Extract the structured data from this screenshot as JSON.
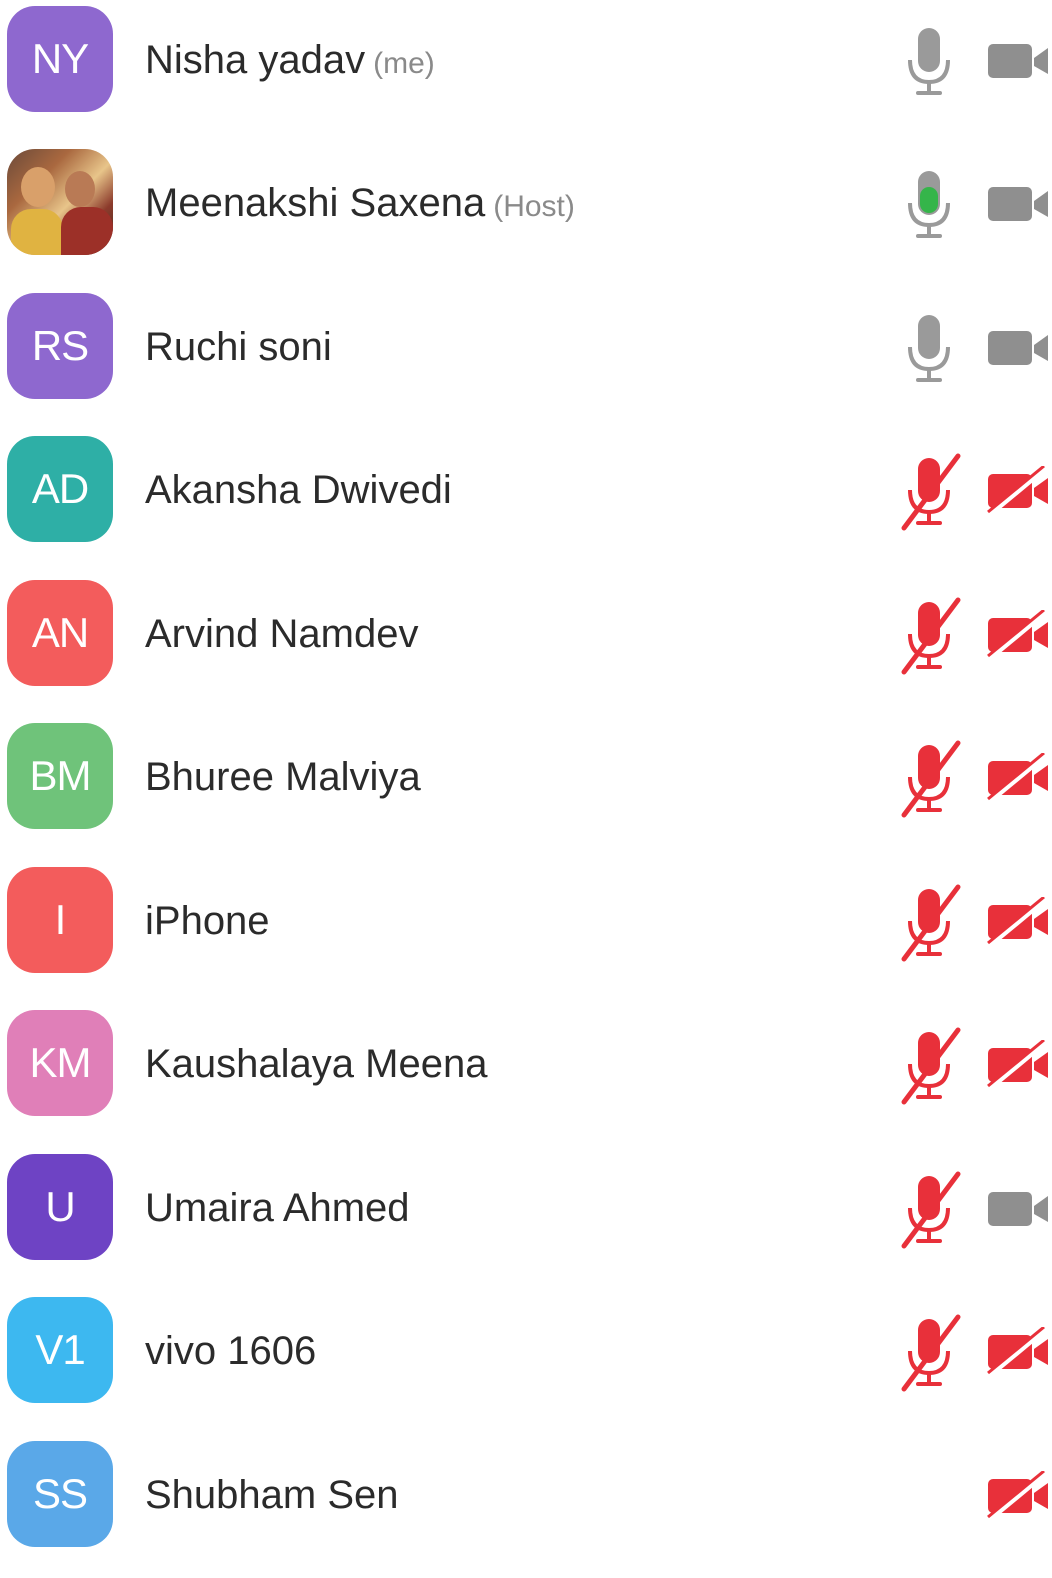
{
  "participants": [
    {
      "initials": "NY",
      "name": "Nisha yadav",
      "tag": "(me)",
      "color": "#8e68cf",
      "mic": "idle",
      "camera": "idle"
    },
    {
      "initials": "",
      "name": "Meenakshi Saxena",
      "tag": "(Host)",
      "color": "#7a4f3a",
      "avatar": "photo",
      "mic": "speaking",
      "camera": "idle"
    },
    {
      "initials": "RS",
      "name": "Ruchi soni",
      "tag": "",
      "color": "#8e68cf",
      "mic": "idle",
      "camera": "idle"
    },
    {
      "initials": "AD",
      "name": "Akansha Dwivedi",
      "tag": "",
      "color": "#2eafa6",
      "mic": "muted",
      "camera": "off"
    },
    {
      "initials": "AN",
      "name": "Arvind Namdev",
      "tag": "",
      "color": "#f35c5c",
      "mic": "muted",
      "camera": "off"
    },
    {
      "initials": "BM",
      "name": "Bhuree Malviya",
      "tag": "",
      "color": "#6fc37a",
      "mic": "muted",
      "camera": "off"
    },
    {
      "initials": "I",
      "name": "iPhone",
      "tag": "",
      "color": "#f35c5c",
      "mic": "muted",
      "camera": "off"
    },
    {
      "initials": "KM",
      "name": "Kaushalaya Meena",
      "tag": "",
      "color": "#e07fb8",
      "mic": "muted",
      "camera": "off"
    },
    {
      "initials": "U",
      "name": "Umaira Ahmed",
      "tag": "",
      "color": "#6e43c4",
      "mic": "muted",
      "camera": "idle"
    },
    {
      "initials": "V1",
      "name": "vivo 1606",
      "tag": "",
      "color": "#3db8f0",
      "mic": "muted",
      "camera": "off"
    },
    {
      "initials": "SS",
      "name": "Shubham Sen",
      "tag": "",
      "color": "#5aa8e8",
      "mic": "none",
      "camera": "off"
    }
  ],
  "icons": {
    "mic_idle_color": "#9a9a9a",
    "mic_speaking_color": "#35b54a",
    "muted_color": "#e8303a",
    "camera_idle_color": "#8f8f8f"
  }
}
